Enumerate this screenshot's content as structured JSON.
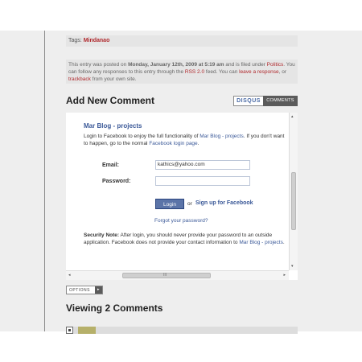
{
  "tags": {
    "label": "Tags:",
    "value": "Mindanao"
  },
  "entry_meta": {
    "t1": "This entry was posted on ",
    "date": "Monday, January 12th, 2009 at 5:19 am",
    "t2": " and is filed under",
    "category": "Politics",
    "t3": ". You can follow any responses to this entry through the ",
    "rss": "RSS 2.0",
    "t4": " feed. You can ",
    "leave": "leave a response",
    "t5": ", or ",
    "trackback": "trackback",
    "t6": " from your own site."
  },
  "comment_header": {
    "title": "Add New Comment",
    "disqus_label": "DISQUS",
    "comments_label": "COMMENTS"
  },
  "facebook_login": {
    "app_name": "Mar Blog - projects",
    "desc_1": "Login to Facebook to enjoy the full functionality of ",
    "desc_link": "Mar Blog - projects",
    "desc_2": ". If you don't want",
    "desc_3": "to happen, go to the normal ",
    "desc_link2": "Facebook login page",
    "desc_4": ".",
    "email_label": "Email:",
    "email_value": "kathics@yahoo.com",
    "password_label": "Password:",
    "login_button": "Login",
    "or_text": "or",
    "signup_link": "Sign up for Facebook",
    "forgot_link": "Forgot your password?",
    "security_bold": "Security Note:",
    "security_1": " After login, you should never provide your password to an outside",
    "security_2": "application. Facebook does not provide your contact information to ",
    "security_link": "Mar Blog - projects",
    "security_3": "."
  },
  "options_button": "OPTIONS",
  "options_arrow": "▸",
  "viewing": "Viewing 2 Comments",
  "scroll": {
    "left": "◂",
    "right": "▸",
    "up": "▴",
    "down": "▾",
    "grip": "III"
  }
}
